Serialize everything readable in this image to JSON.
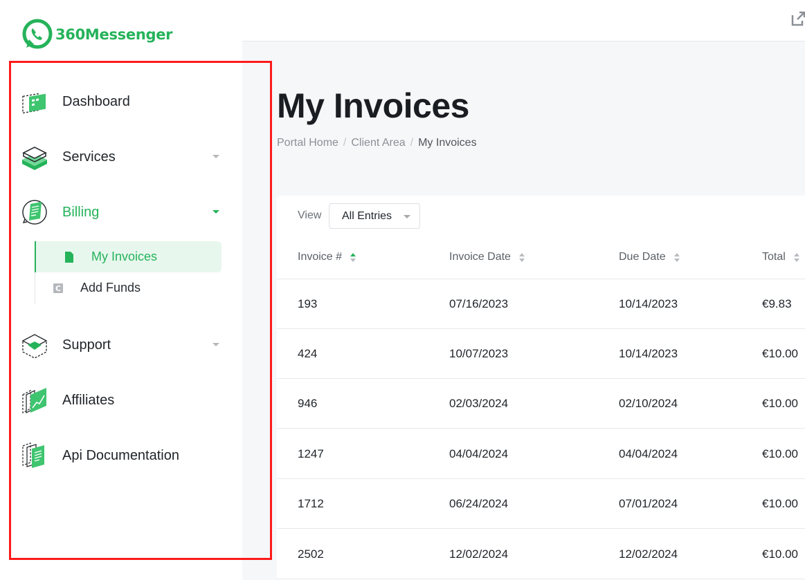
{
  "brand": {
    "name": "360Messenger",
    "color": "#25b35a"
  },
  "sidebar": {
    "items": [
      {
        "label": "Dashboard",
        "icon": "dashboard-icon",
        "expandable": false
      },
      {
        "label": "Services",
        "icon": "services-icon",
        "expandable": true
      },
      {
        "label": "Billing",
        "icon": "billing-icon",
        "expandable": true,
        "active": true,
        "children": [
          {
            "label": "My Invoices",
            "icon": "document-icon",
            "active": true
          },
          {
            "label": "Add Funds",
            "icon": "wallet-icon"
          }
        ]
      },
      {
        "label": "Support",
        "icon": "support-icon",
        "expandable": true
      },
      {
        "label": "Affiliates",
        "icon": "affiliates-icon",
        "expandable": false
      },
      {
        "label": "Api Documentation",
        "icon": "api-docs-icon",
        "expandable": false
      }
    ]
  },
  "page": {
    "title": "My Invoices",
    "breadcrumb": [
      "Portal Home",
      "Client Area",
      "My Invoices"
    ]
  },
  "table": {
    "view_label": "View",
    "view_select": "All Entries",
    "columns": [
      "Invoice #",
      "Invoice Date",
      "Due Date",
      "Total"
    ],
    "sorted_column": "Invoice #",
    "rows": [
      [
        "193",
        "07/16/2023",
        "10/14/2023",
        "€9.83"
      ],
      [
        "424",
        "10/07/2023",
        "10/14/2023",
        "€10.00"
      ],
      [
        "946",
        "02/03/2024",
        "02/10/2024",
        "€10.00"
      ],
      [
        "1247",
        "04/04/2024",
        "04/04/2024",
        "€10.00"
      ],
      [
        "1712",
        "06/24/2024",
        "07/01/2024",
        "€10.00"
      ],
      [
        "2502",
        "12/02/2024",
        "12/02/2024",
        "€10.00"
      ]
    ]
  }
}
